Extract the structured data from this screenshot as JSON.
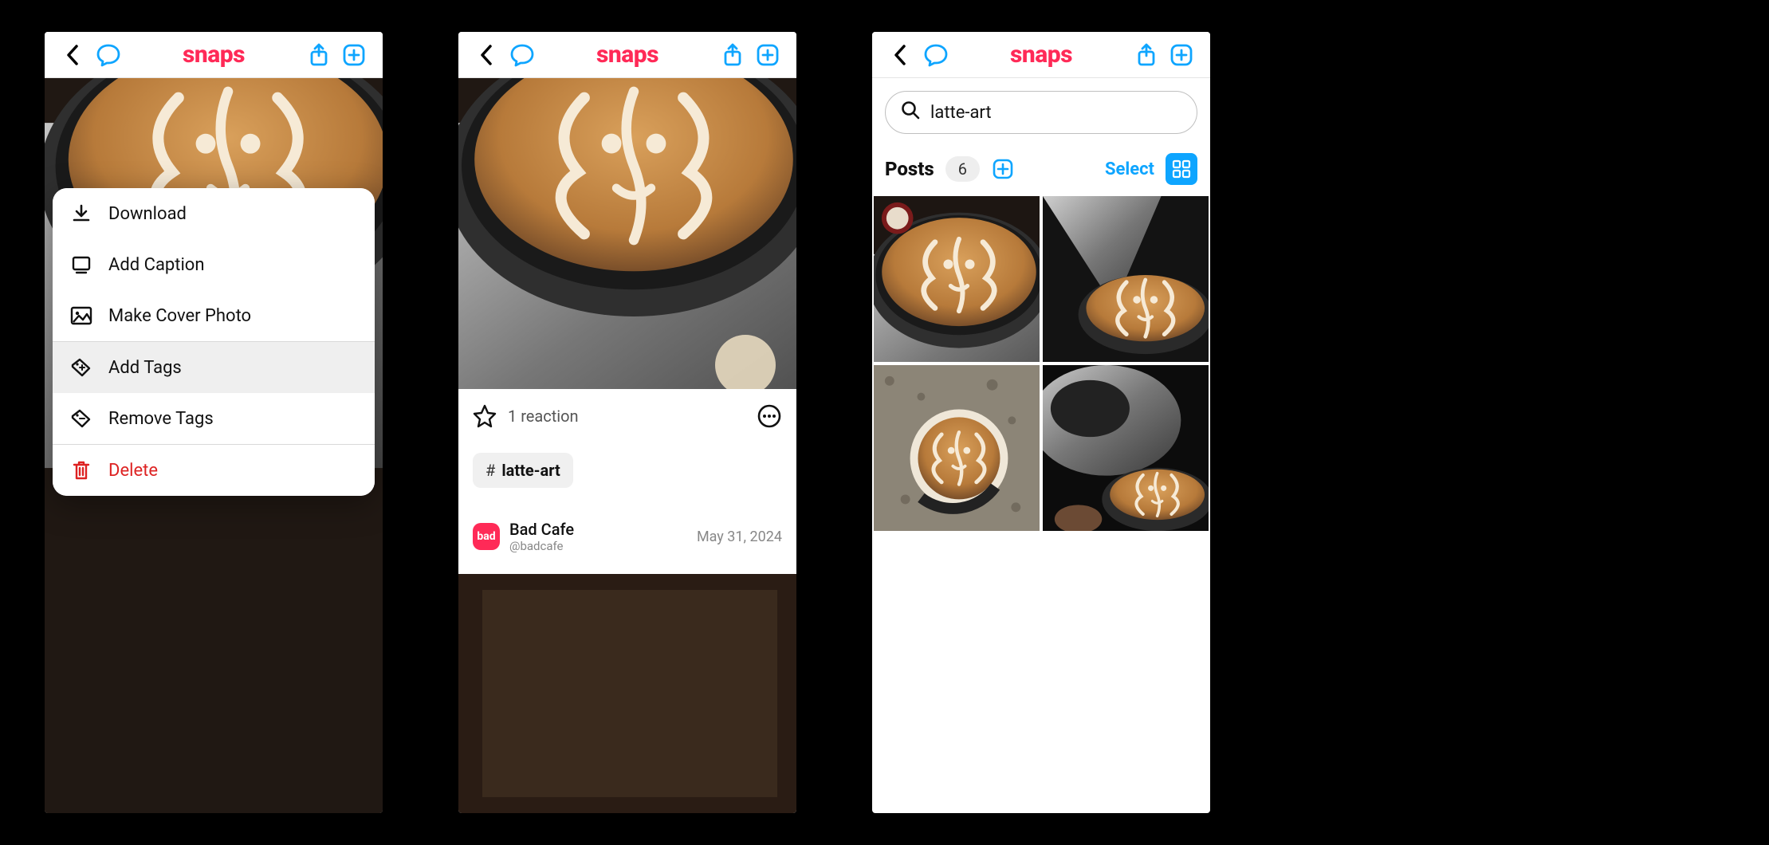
{
  "app": {
    "name": "snaps"
  },
  "colors": {
    "accent": "#0ea5ff",
    "brand": "#ff2a57",
    "danger": "#d22"
  },
  "phone1": {
    "menu": {
      "download": "Download",
      "add_caption": "Add Caption",
      "make_cover": "Make Cover Photo",
      "add_tags": "Add Tags",
      "remove_tags": "Remove Tags",
      "delete": "Delete"
    }
  },
  "phone2": {
    "reactions_text": "1 reaction",
    "tag_label": "latte-art",
    "author": {
      "name": "Bad Cafe",
      "handle": "@badcafe",
      "avatar_text": "bad"
    },
    "date": "May 31, 2024"
  },
  "phone3": {
    "search_value": "latte-art",
    "posts_label": "Posts",
    "posts_count": "6",
    "select_label": "Select"
  }
}
